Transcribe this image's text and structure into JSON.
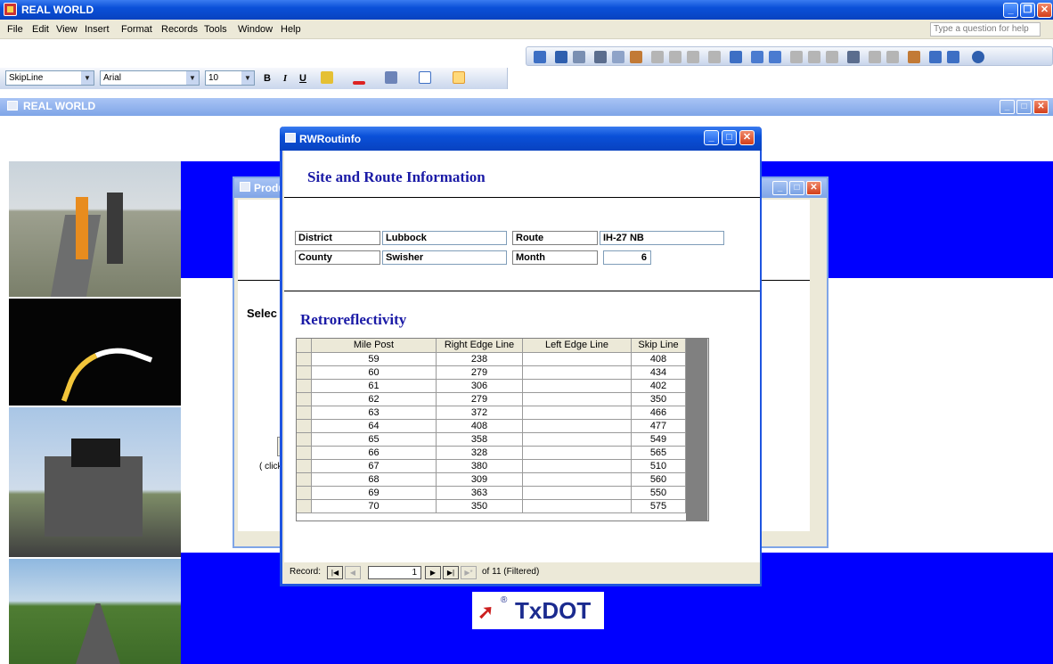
{
  "app": {
    "title": "REAL WORLD"
  },
  "menu": {
    "items": [
      "File",
      "Edit",
      "View",
      "Insert",
      "Format",
      "Records",
      "Tools",
      "Window",
      "Help"
    ],
    "help_placeholder": "Type a question for help"
  },
  "format_bar": {
    "object_combo": "SkipLine",
    "font_combo": "Arial",
    "size_combo": "10",
    "bold": "B",
    "italic": "I",
    "underline": "U"
  },
  "mdi": {
    "title": "REAL WORLD"
  },
  "products_window": {
    "title_partial": "Produ",
    "select_partial": "Selec",
    "click_partial": "( click"
  },
  "form": {
    "title": "RWRoutinfo",
    "site_header": "Site and Route Information",
    "district_label": "District",
    "district_value": "Lubbock",
    "route_label": "Route",
    "route_value": "IH-27 NB",
    "county_label": "County",
    "county_value": "Swisher",
    "month_label": "Month",
    "month_value": "6",
    "retro_header": "Retroreflectivity"
  },
  "grid": {
    "columns": [
      "Mile Post",
      "Right Edge Line",
      "Left Edge Line",
      "Skip Line"
    ],
    "rows": [
      [
        "59",
        "238",
        "",
        "408"
      ],
      [
        "60",
        "279",
        "",
        "434"
      ],
      [
        "61",
        "306",
        "",
        "402"
      ],
      [
        "62",
        "279",
        "",
        "350"
      ],
      [
        "63",
        "372",
        "",
        "466"
      ],
      [
        "64",
        "408",
        "",
        "477"
      ],
      [
        "65",
        "358",
        "",
        "549"
      ],
      [
        "66",
        "328",
        "",
        "565"
      ],
      [
        "67",
        "380",
        "",
        "510"
      ],
      [
        "68",
        "309",
        "",
        "560"
      ],
      [
        "69",
        "363",
        "",
        "550"
      ],
      [
        "70",
        "350",
        "",
        "575"
      ]
    ]
  },
  "nav": {
    "record_label": "Record:",
    "current": "1",
    "of_text": "of 11 (Filtered)"
  },
  "logo": {
    "text": "TxDOT",
    "reg": "®"
  },
  "colors": {
    "xp_title": "#0a50d8",
    "band_blue": "#0000ff",
    "header_text": "#1a1aa6",
    "face": "#ece9d8"
  }
}
